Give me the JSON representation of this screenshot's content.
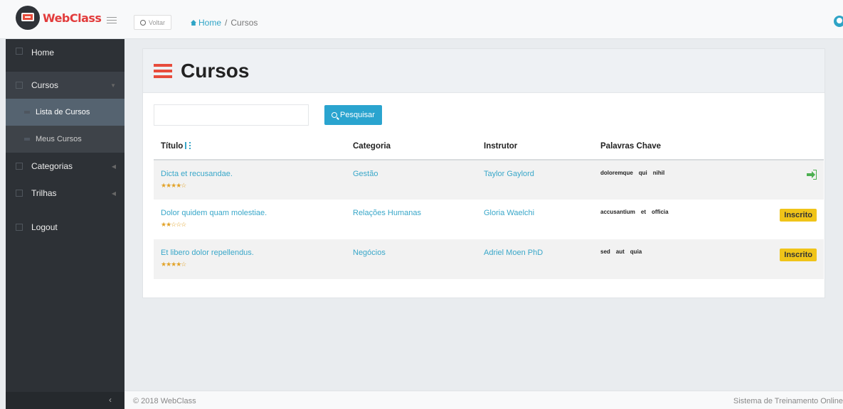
{
  "header": {
    "brand": "WebClass",
    "back_label": "Voltar",
    "breadcrumb": {
      "home": "Home",
      "separator": "/",
      "current": "Cursos"
    }
  },
  "sidebar": {
    "items": [
      {
        "label": "Home"
      },
      {
        "label": "Cursos",
        "expanded": true
      },
      {
        "label": "Lista de Cursos",
        "active": true
      },
      {
        "label": "Meus Cursos"
      },
      {
        "label": "Categorias"
      },
      {
        "label": "Trilhas"
      },
      {
        "label": "Logout"
      }
    ],
    "collapse_icon": "chevron-left-icon"
  },
  "page": {
    "title": "Cursos",
    "search": {
      "value": "",
      "button_label": "Pesquisar"
    },
    "table": {
      "headers": [
        "Título",
        "Categoria",
        "Instrutor",
        "Palavras Chave",
        ""
      ],
      "rows": [
        {
          "titulo": "Dicta et recusandae.",
          "rating": 4,
          "stars": "★★★★☆",
          "categoria": "Gestão",
          "instrutor": "Taylor Gaylord",
          "palavras": [
            "doloremque",
            "qui",
            "nihil"
          ],
          "action": "enter-icon"
        },
        {
          "titulo": "Dolor quidem quam molestiae.",
          "rating": 2,
          "stars": "★★☆☆☆",
          "categoria": "Relações Humanas",
          "instrutor": "Gloria Waelchi",
          "palavras": [
            "accusantium",
            "et",
            "officia"
          ],
          "action": "Inscrito"
        },
        {
          "titulo": "Et libero dolor repellendus.",
          "rating": 4,
          "stars": "★★★★☆",
          "categoria": "Negócios",
          "instrutor": "Adriel Moen PhD",
          "palavras": [
            "sed",
            "aut",
            "quia"
          ],
          "action": "Inscrito"
        }
      ]
    }
  },
  "footer": {
    "copyright": "© 2018 WebClass",
    "tagline": "Sistema de Treinamento Online"
  },
  "colors": {
    "brand": "#e23c3c",
    "link": "#39a7c9",
    "button": "#2aa4cf",
    "badge": "#f0c419",
    "sidebar": "#2d3136"
  }
}
